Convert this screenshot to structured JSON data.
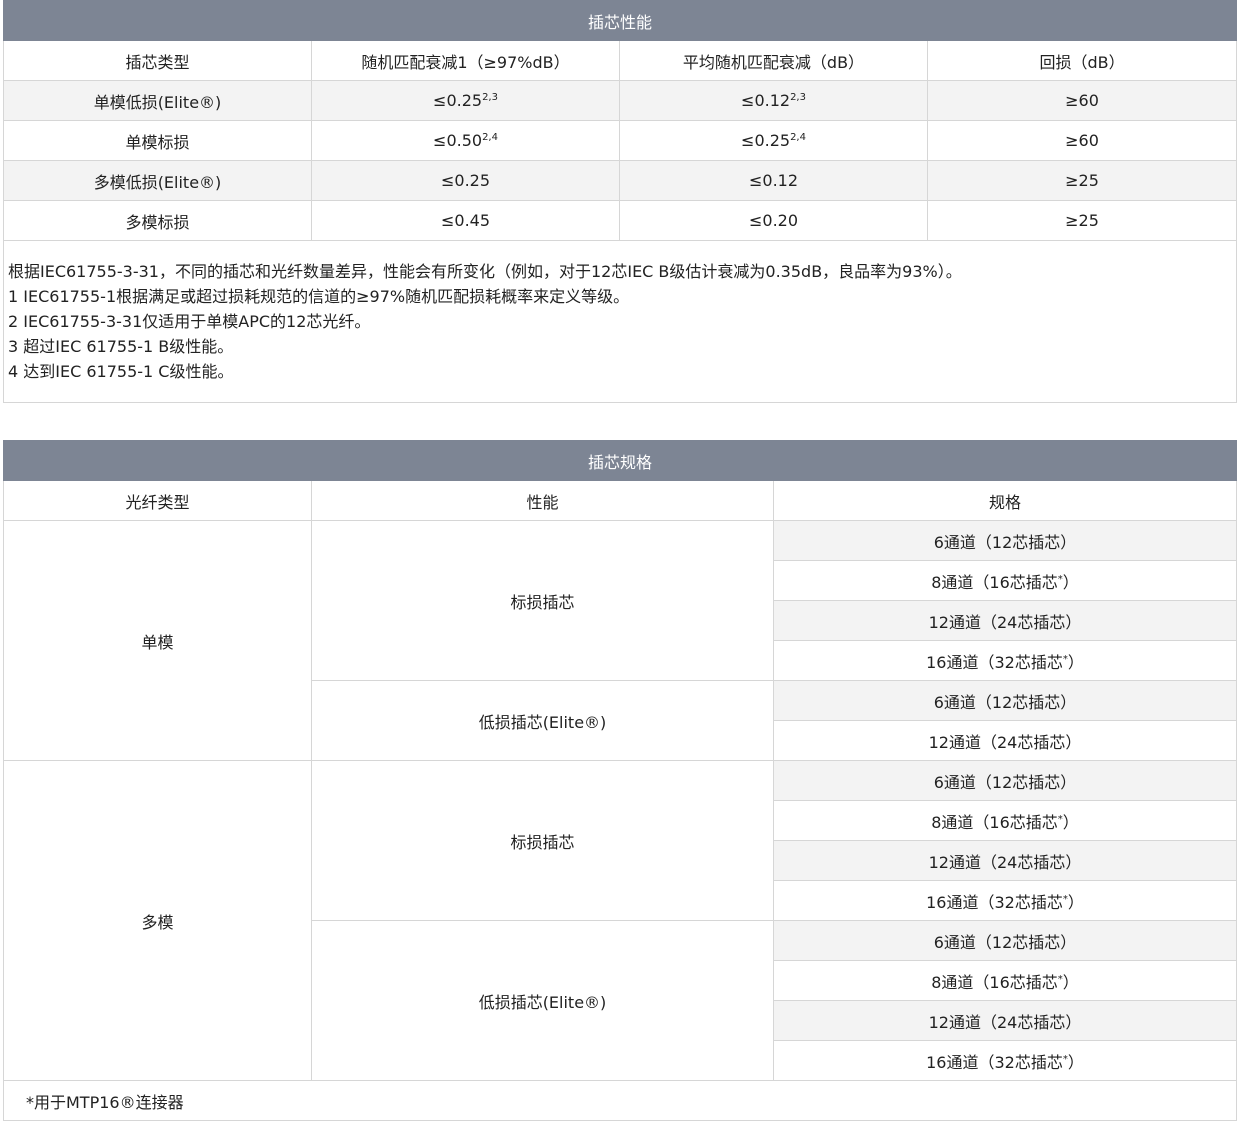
{
  "perf": {
    "title": "插芯性能",
    "headers": [
      "插芯类型",
      "随机匹配衰减1（≥97%dB）",
      "平均随机匹配衰减（dB）",
      "回损（dB）"
    ],
    "rows": [
      {
        "type": "单模低损(Elite®)",
        "c1": "≤0.25",
        "c1sup": "2,3",
        "c2": "≤0.12",
        "c2sup": "2,3",
        "c3": "≥60"
      },
      {
        "type": "单模标损",
        "c1": "≤0.50",
        "c1sup": "2,4",
        "c2": "≤0.25",
        "c2sup": "2,4",
        "c3": "≥60"
      },
      {
        "type": "多模低损(Elite®)",
        "c1": "≤0.25",
        "c1sup": "",
        "c2": "≤0.12",
        "c2sup": "",
        "c3": "≥25"
      },
      {
        "type": "多模标损",
        "c1": "≤0.45",
        "c1sup": "",
        "c2": "≤0.20",
        "c2sup": "",
        "c3": "≥25"
      }
    ],
    "notes": [
      "根据IEC61755-3-31，不同的插芯和光纤数量差异，性能会有所变化（例如，对于12芯IEC B级估计衰减为0.35dB，良品率为93%）。",
      "1 IEC61755-1根据满足或超过损耗规范的信道的≥97%随机匹配损耗概率来定义等级。",
      "2 IEC61755-3-31仅适用于单模APC的12芯光纤。",
      "3 超过IEC 61755-1 B级性能。",
      "4 达到IEC 61755-1 C级性能。"
    ]
  },
  "spec": {
    "title": "插芯规格",
    "headers": [
      "光纤类型",
      "性能",
      "规格"
    ],
    "singlemode": "单模",
    "multimode": "多模",
    "std": "标损插芯",
    "elite": "低损插芯(Elite®)",
    "sm_std": [
      "6通道（12芯插芯）",
      "8通道（16芯插芯",
      "12通道（24芯插芯）",
      "16通道（32芯插芯"
    ],
    "sm_elite": [
      "6通道（12芯插芯）",
      "12通道（24芯插芯）"
    ],
    "mm_std": [
      "6通道（12芯插芯）",
      "8通道（16芯插芯",
      "12通道（24芯插芯）",
      "16通道（32芯插芯"
    ],
    "mm_elite": [
      "6通道（12芯插芯）",
      "8通道（16芯插芯",
      "12通道（24芯插芯）",
      "16通道（32芯插芯"
    ],
    "star": "*",
    "close": "）",
    "footnote": "*用于MTP16®连接器"
  }
}
